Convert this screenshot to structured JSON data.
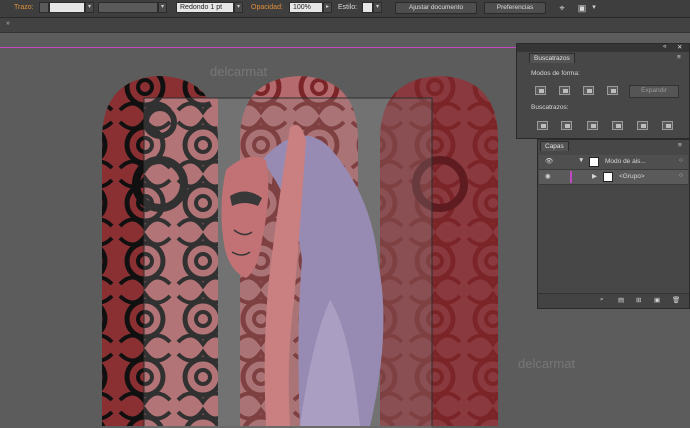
{
  "control_bar": {
    "stroke_label": "Trazo:",
    "stroke_value": "",
    "profile_value": "",
    "brush_value": "Redondo 1 pt",
    "opacity_label": "Opacidad:",
    "opacity_value": "100%",
    "style_label": "Estilo:",
    "arrange_button": "Ajustar documento",
    "preferences_button": "Preferencias"
  },
  "pathfinder": {
    "tab": "Buscatrazos",
    "shape_modes_label": "Modos de forma:",
    "expand_button": "Expandir",
    "pathfinders_label": "Buscatrazos:"
  },
  "layers": {
    "tab": "Capas",
    "layer_name": "Modo de ais...",
    "group_name": "<Grupo>"
  },
  "canvas": {
    "watermark_top": "delcarmat",
    "watermark_bottom": "delcarmat"
  },
  "colors": {
    "accent_orange": "#e0903a",
    "artboard_edge": "#c247c2",
    "window_dark": "#8a2f32",
    "window_light": "#c46d71",
    "figure_purple": "#9e8dc4",
    "figure_pink": "#e37c7d"
  }
}
